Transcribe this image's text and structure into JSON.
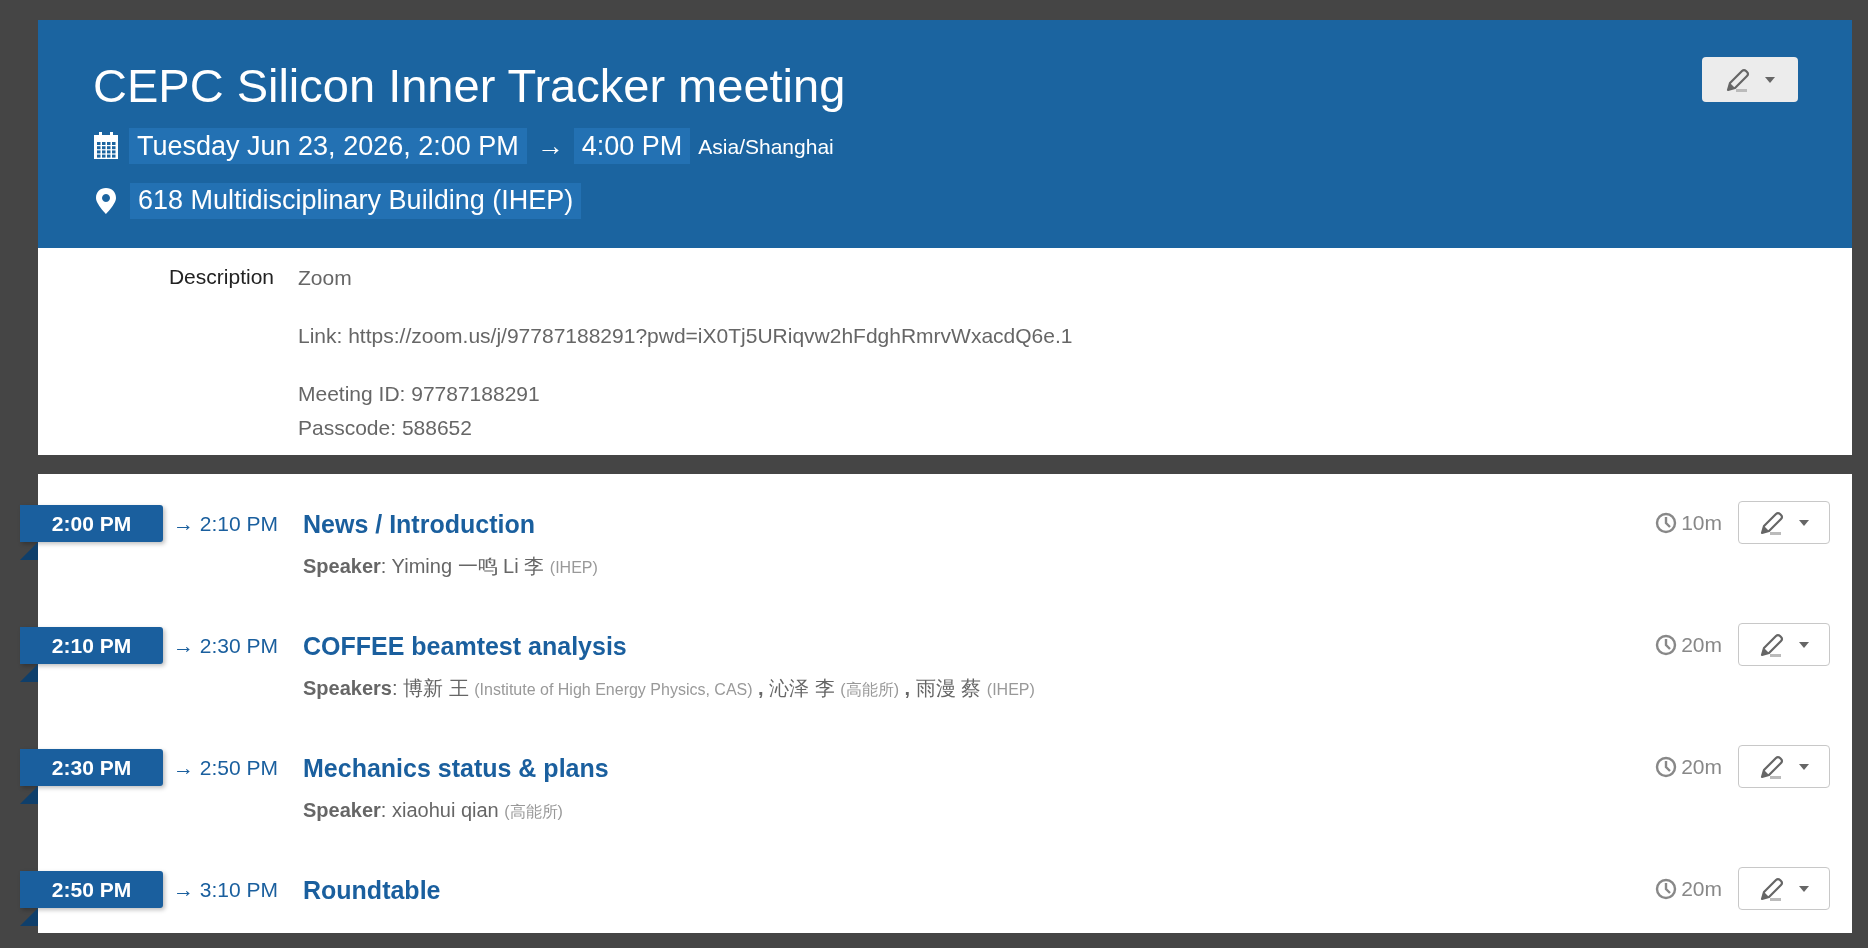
{
  "event": {
    "title": "CEPC Silicon Inner Tracker meeting",
    "start": "Tuesday Jun 23, 2026, 2:00 PM",
    "arrow": "→",
    "end": "4:00 PM",
    "timezone": "Asia/Shanghai",
    "location": "618 Multidisciplinary Building (IHEP)"
  },
  "description": {
    "label": "Description",
    "paragraphs": [
      [
        "Zoom"
      ],
      [
        "Link: https://zoom.us/j/97787188291?pwd=iX0Tj5URiqvw2hFdghRmrvWxacdQ6e.1"
      ],
      [
        "Meeting ID: 97787188291",
        "Passcode: 588652"
      ]
    ]
  },
  "contributions": [
    {
      "start": "2:00 PM",
      "end": "→ 2:10 PM",
      "title": "News / Introduction",
      "speakers_label": "**Speaker**:",
      "speakers": [
        {
          "name": "Yiming 一鸣 Li 李",
          "affiliation": "(IHEP)"
        }
      ],
      "duration": "10m"
    },
    {
      "start": "2:10 PM",
      "end": "→ 2:30 PM",
      "title": "COFFEE beamtest analysis",
      "speakers_label": "**Speakers**:",
      "speakers": [
        {
          "name": "博新 王",
          "affiliation": "(Institute of High Energy Physics, CAS)",
          "separator": ","
        },
        {
          "name": "沁泽 李",
          "affiliation": "(高能所)",
          "separator": ","
        },
        {
          "name": "雨漫 蔡",
          "affiliation": "(IHEP)"
        }
      ],
      "duration": "20m"
    },
    {
      "start": "2:30 PM",
      "end": "→ 2:50 PM",
      "title": "Mechanics status & plans",
      "speakers_label": "**Speaker**:",
      "speakers": [
        {
          "name": "xiaohui qian",
          "affiliation": "(高能所)"
        }
      ],
      "duration": "20m"
    },
    {
      "start": "2:50 PM",
      "end": "→ 3:10 PM",
      "title": "Roundtable",
      "duration": "20m"
    }
  ]
}
